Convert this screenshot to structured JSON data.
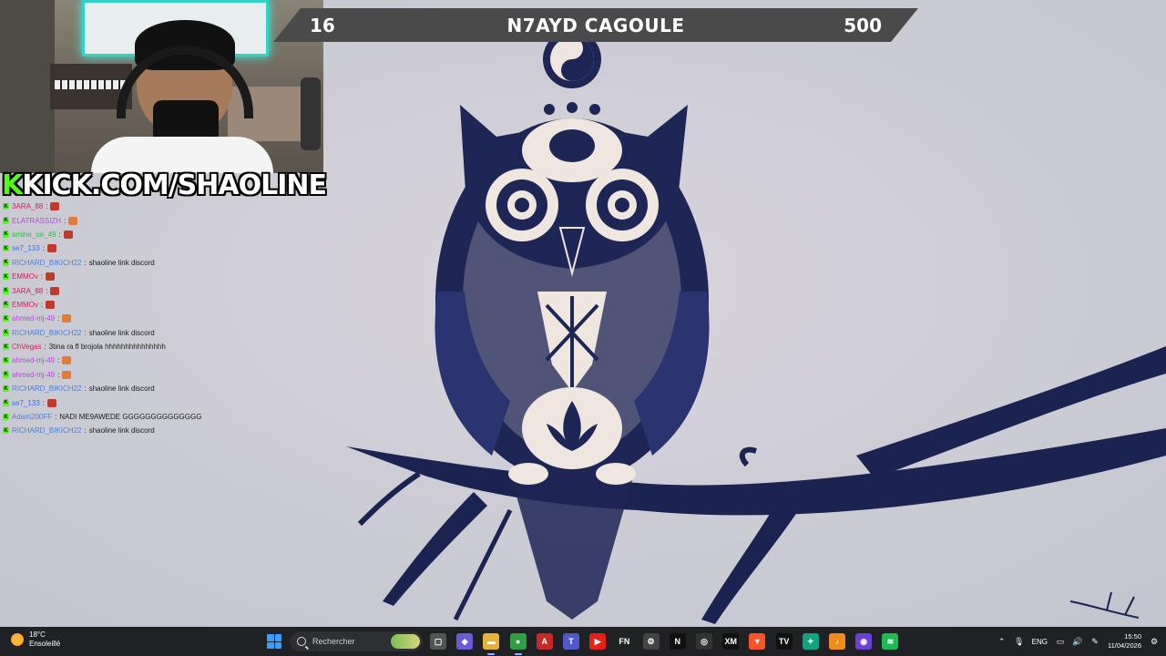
{
  "stream": {
    "banner_prefix": "K",
    "banner_text": "KICK.COM/SHAOLINE"
  },
  "scoreboard": {
    "left": "16",
    "title": "N7AYD CAGOULE",
    "right": "500"
  },
  "chat": [
    {
      "user": "3ARA_88",
      "color": "#d0205a",
      "msg": "",
      "emote": true
    },
    {
      "user": "ELATRASSIZH",
      "color": "#b44ad8",
      "msg": "",
      "emote": true
    },
    {
      "user": "amine_ue_49",
      "color": "#22c23a",
      "msg": "",
      "emote": true
    },
    {
      "user": "se7_133",
      "color": "#3b6fe0",
      "msg": "",
      "emote": true
    },
    {
      "user": "RICHARD_BIKICH22",
      "color": "#4a7fd6",
      "msg": "shaoline link discord",
      "emote": false
    },
    {
      "user": "EMMOv",
      "color": "#d0205a",
      "msg": "",
      "emote": true
    },
    {
      "user": "3ARA_88",
      "color": "#d0205a",
      "msg": "",
      "emote": true
    },
    {
      "user": "EMMOv",
      "color": "#d0205a",
      "msg": "",
      "emote": true
    },
    {
      "user": "ahmed-mj-49",
      "color": "#b44ad8",
      "msg": "",
      "emote": true
    },
    {
      "user": "RICHARD_BIKICH22",
      "color": "#4a7fd6",
      "msg": "shaoline link discord",
      "emote": false
    },
    {
      "user": "ChVegas",
      "color": "#d0205a",
      "msg": "3tina ra fl brojola hhhhhhhhhhhhhhh",
      "emote": false
    },
    {
      "user": "ahmed-mj-49",
      "color": "#b44ad8",
      "msg": "",
      "emote": true
    },
    {
      "user": "ahmed-mj-49",
      "color": "#b44ad8",
      "msg": "",
      "emote": true
    },
    {
      "user": "RICHARD_BIKICH22",
      "color": "#4a7fd6",
      "msg": "shaoline link discord",
      "emote": false
    },
    {
      "user": "se7_133",
      "color": "#3b6fe0",
      "msg": "",
      "emote": true
    },
    {
      "user": "Adam200FF",
      "color": "#4a7fd6",
      "msg": "NADI ME9AWEDE GGGGGGGGGGGGGG",
      "emote": false
    },
    {
      "user": "RICHARD_BIKICH22",
      "color": "#4a7fd6",
      "msg": "shaoline link discord",
      "emote": false
    }
  ],
  "taskbar": {
    "weather_temp": "18°C",
    "weather_desc": "Ensoleillé",
    "search_placeholder": "Rechercher",
    "language": "ENG",
    "time": "15:50",
    "date": "11/04/2026",
    "apps": [
      {
        "name": "task-view",
        "color": "#555",
        "glyph": "▢"
      },
      {
        "name": "copilot",
        "color": "#6b5bd6",
        "glyph": "◆"
      },
      {
        "name": "file-explorer",
        "color": "#e6b33a",
        "glyph": "▬",
        "active": true
      },
      {
        "name": "chrome",
        "color": "#2f9e44",
        "glyph": "●",
        "active": true
      },
      {
        "name": "adobe",
        "color": "#c62828",
        "glyph": "A"
      },
      {
        "name": "teams",
        "color": "#5059c9",
        "glyph": "T"
      },
      {
        "name": "youtube",
        "color": "#e62117",
        "glyph": "▶"
      },
      {
        "name": "fn-app",
        "color": "#222",
        "glyph": "FN"
      },
      {
        "name": "steam-like",
        "color": "#444",
        "glyph": "⚙"
      },
      {
        "name": "netflix",
        "color": "#111",
        "glyph": "N"
      },
      {
        "name": "github",
        "color": "#333",
        "glyph": "◎"
      },
      {
        "name": "xm",
        "color": "#111",
        "glyph": "XM"
      },
      {
        "name": "brave",
        "color": "#fb542b",
        "glyph": "▼"
      },
      {
        "name": "tradingview",
        "color": "#111",
        "glyph": "TV"
      },
      {
        "name": "chatgpt-app",
        "color": "#10a37f",
        "glyph": "✦"
      },
      {
        "name": "fl-studio",
        "color": "#f08c1a",
        "glyph": "♪"
      },
      {
        "name": "obs",
        "color": "#6c3fd6",
        "glyph": "◉"
      },
      {
        "name": "spotify",
        "color": "#1db954",
        "glyph": "≋"
      }
    ]
  }
}
